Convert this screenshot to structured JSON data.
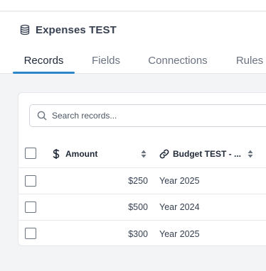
{
  "header": {
    "title": "Expenses TEST",
    "icon": "database-icon"
  },
  "tabs": [
    {
      "label": "Records",
      "active": true
    },
    {
      "label": "Fields",
      "active": false
    },
    {
      "label": "Connections",
      "active": false
    },
    {
      "label": "Rules",
      "active": false
    }
  ],
  "search": {
    "placeholder": "Search records...",
    "value": ""
  },
  "table": {
    "columns": [
      {
        "label": "Amount",
        "icon": "dollar-icon"
      },
      {
        "label": "Budget TEST - ...",
        "icon": "link-icon"
      }
    ],
    "rows": [
      {
        "amount": "$250",
        "budget": "Year 2025"
      },
      {
        "amount": "$500",
        "budget": "Year 2024"
      },
      {
        "amount": "$300",
        "budget": "Year 2025"
      }
    ]
  },
  "colors": {
    "accent": "#2a86c8",
    "background": "#f3f4f6",
    "border": "#e5e7eb"
  }
}
